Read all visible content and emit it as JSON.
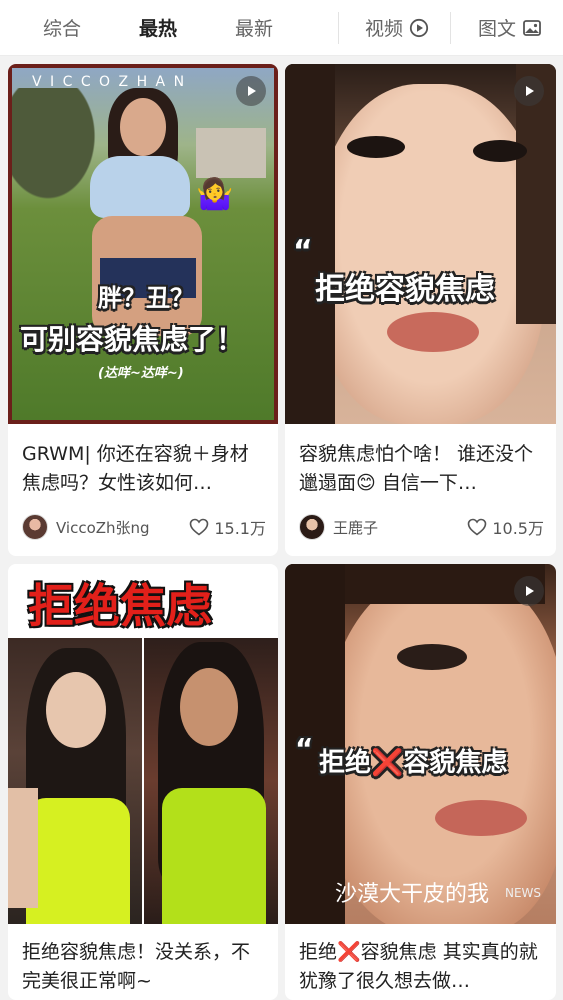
{
  "tabs": {
    "all": "综合",
    "hot": "最热",
    "new": "最新",
    "video": "视频",
    "text": "图文"
  },
  "cards": [
    {
      "title": "GRWM| 你还在容貌＋身材焦虑吗？女性该如何…",
      "author": "ViccoZh张ng",
      "likes": "15.1万",
      "overlay": {
        "watermark": "V I C C O Z H A N",
        "line1": "胖？丑？",
        "line2": "可别容貌焦虑了！",
        "line3": "(达咩~达咩~)"
      }
    },
    {
      "title": "容貌焦虑怕个啥！ 谁还没个邋遢面😊 自信一下…",
      "author": "王鹿子",
      "likes": "10.5万",
      "overlay": {
        "quote": "“",
        "line1": "拒绝容貌焦虑"
      }
    },
    {
      "title": "拒绝容貌焦虑！没关系，不完美很正常啊~",
      "overlay": {
        "line1": "拒绝焦虑"
      }
    },
    {
      "title": "拒绝❌容貌焦虑 其实真的就犹豫了很久想去做…",
      "overlay": {
        "quote": "“",
        "line1": "拒绝❌容貌焦虑",
        "line2": "沙漠大干皮的我",
        "line3": "NEWS"
      }
    }
  ]
}
